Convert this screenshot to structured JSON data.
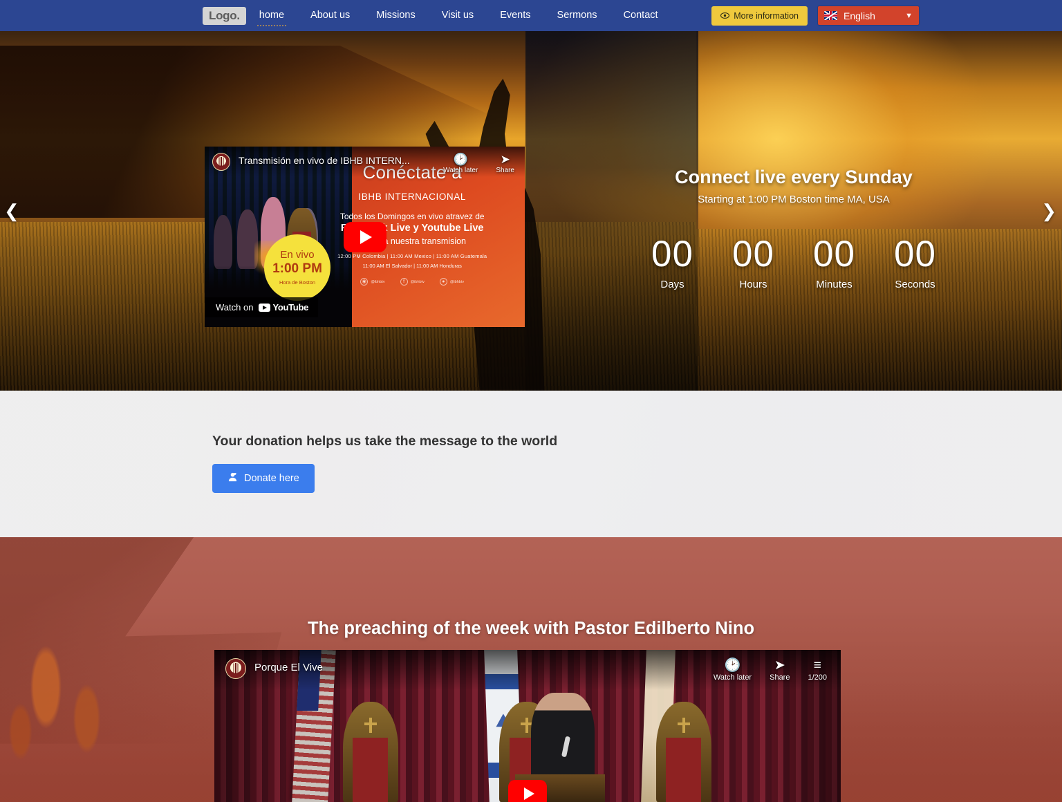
{
  "navbar": {
    "logo": "Logo.",
    "links": [
      {
        "label": "home",
        "active": true
      },
      {
        "label": "About us",
        "active": false
      },
      {
        "label": "Missions",
        "active": false
      },
      {
        "label": "Visit us",
        "active": false
      },
      {
        "label": "Events",
        "active": false
      },
      {
        "label": "Sermons",
        "active": false
      },
      {
        "label": "Contact",
        "active": false
      }
    ],
    "more_info_label": "More information",
    "more_info_icon": "eye-icon",
    "more_info_color": "#EFC93D",
    "language_label": "English",
    "language_flag": "uk-flag-icon",
    "language_color": "#D2432B",
    "bg_color": "#2C4692"
  },
  "hero": {
    "prev_icon": "chevron-left-icon",
    "next_icon": "chevron-right-icon",
    "video": {
      "channel_icon": "ibhb-logo-icon",
      "title": "Transmisión en vivo de IBHB INTERN...",
      "watch_later_label": "Watch later",
      "watch_later_icon": "clock-icon",
      "share_label": "Share",
      "share_icon": "share-arrow-icon",
      "play_icon": "play-button-icon",
      "watch_on_label": "Watch on",
      "watch_on_brand": "YouTube",
      "overlay": {
        "headline": "Conéctate a",
        "subhead": "IBHB INTERNACIONAL",
        "line1": "Todos los Domingos en vivo atravez de",
        "line2": "Facebook Live y Youtube Live",
        "line3": "Disfruta nuestra transmision",
        "times1": "12:00 PM Colombia | 11:00 AM Mexico | 11:00 AM Guatemala",
        "times2": "11:00 AM El Salvador | 11:00 AM Honduras",
        "socials": [
          {
            "icon": "instagram-icon",
            "handle": "@ibhbtv"
          },
          {
            "icon": "facebook-icon",
            "handle": "@ibhbtv"
          },
          {
            "icon": "twitter-icon",
            "handle": "@ibhbtv"
          }
        ]
      },
      "live_badge": {
        "line1": "En vivo",
        "line2": "1:00 PM",
        "line3": "Hora de Boston"
      }
    },
    "countdown": {
      "title": "Connect live every Sunday",
      "subtitle": "Starting at 1:00 PM Boston time MA, USA",
      "items": [
        {
          "value": "00",
          "label": "Days"
        },
        {
          "value": "00",
          "label": "Hours"
        },
        {
          "value": "00",
          "label": "Minutes"
        },
        {
          "value": "00",
          "label": "Seconds"
        }
      ]
    }
  },
  "donation": {
    "title": "Your donation helps us take the message to the world",
    "button_label": "Donate here",
    "button_icon": "person-heart-icon",
    "button_color": "#3B7DED"
  },
  "preaching": {
    "title": "The preaching of the week with Pastor Edilberto Nino",
    "video": {
      "channel_icon": "ibhb-logo-icon",
      "title": "Porque El Vive",
      "watch_later_label": "Watch later",
      "watch_later_icon": "clock-icon",
      "share_label": "Share",
      "share_icon": "share-arrow-icon",
      "playlist_label": "1/200",
      "playlist_icon": "playlist-icon",
      "play_icon": "play-button-icon"
    }
  }
}
